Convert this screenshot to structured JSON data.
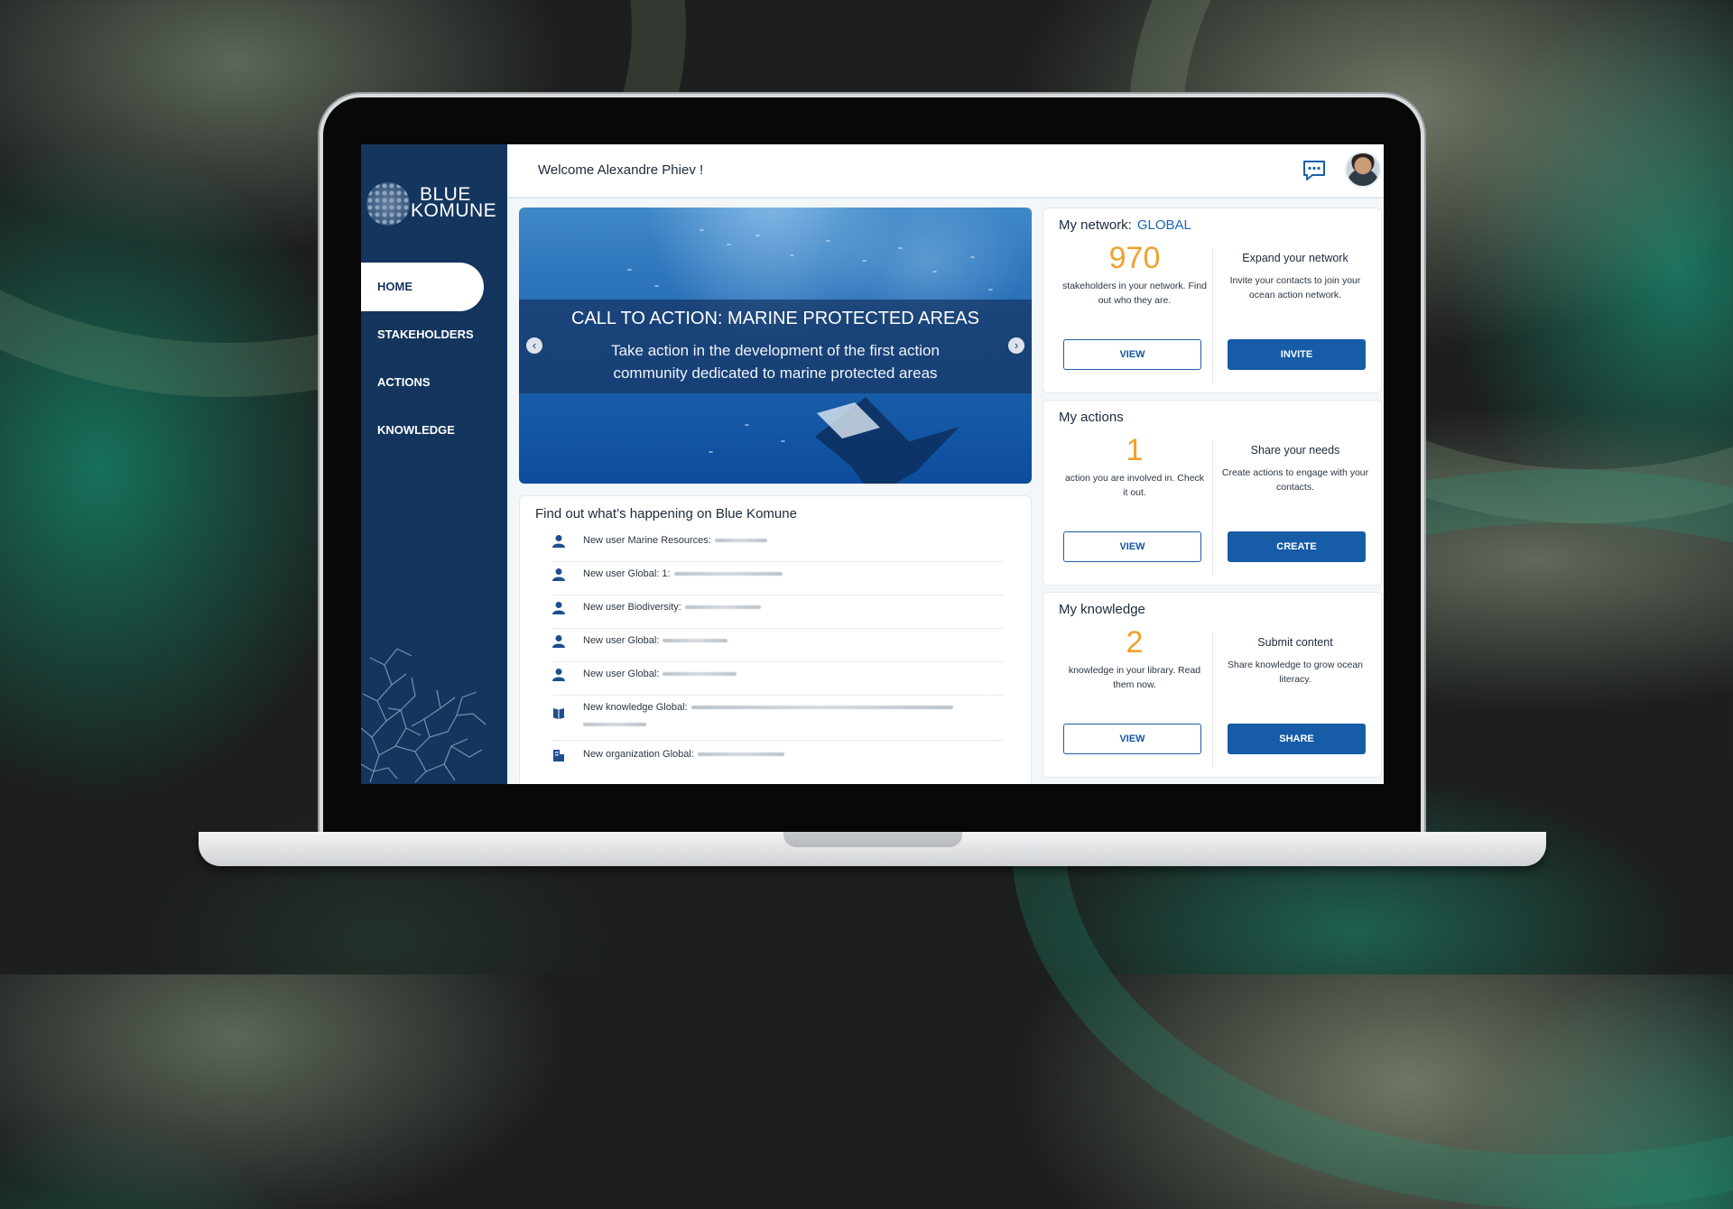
{
  "app": {
    "logo_line1": "BLUE",
    "logo_line2": "KOMUNE",
    "welcome": "Welcome Alexandre Phiev !"
  },
  "sidebar": {
    "items": [
      {
        "label": "HOME",
        "active": true
      },
      {
        "label": "STAKEHOLDERS",
        "active": false
      },
      {
        "label": "ACTIONS",
        "active": false
      },
      {
        "label": "KNOWLEDGE",
        "active": false
      }
    ]
  },
  "icons": {
    "chat": "chat-bubble-icon",
    "user": "user-icon",
    "book": "book-icon",
    "building": "building-icon",
    "prev": "chevron-left-icon",
    "next": "chevron-right-icon"
  },
  "hero": {
    "title": "CALL TO ACTION: MARINE PROTECTED AREAS",
    "text": "Take action in the development of the first action community dedicated to marine protected areas"
  },
  "feed": {
    "title": "Find out what’s happening on Blue Komune",
    "items": [
      {
        "icon": "user-icon",
        "text": "New user Marine Resources:"
      },
      {
        "icon": "user-icon",
        "text": "New user Global: 1:"
      },
      {
        "icon": "user-icon",
        "text": "New user Biodiversity:"
      },
      {
        "icon": "user-icon",
        "text": "New user Global:"
      },
      {
        "icon": "user-icon",
        "text": "New user Global:"
      },
      {
        "icon": "book-icon",
        "text": "New knowledge Global:"
      },
      {
        "icon": "building-icon",
        "text": "New organization Global:"
      }
    ]
  },
  "network": {
    "title": "My network:",
    "scope": "GLOBAL",
    "count": "970",
    "desc": "stakeholders in your network. Find out who they are.",
    "right_title": "Expand your network",
    "right_desc": "Invite your contacts to join your ocean action network.",
    "view_label": "VIEW",
    "action_label": "INVITE"
  },
  "actions": {
    "title": "My actions",
    "count": "1",
    "desc": "action you are involved in. Check it out.",
    "right_title": "Share your needs",
    "right_desc": "Create actions to engage with your contacts.",
    "view_label": "VIEW",
    "action_label": "CREATE"
  },
  "knowledge": {
    "title": "My knowledge",
    "count": "2",
    "desc": "knowledge in your library. Read them now.",
    "right_title": "Submit content",
    "right_desc": "Share knowledge to grow ocean literacy.",
    "view_label": "VIEW",
    "action_label": "SHARE"
  },
  "colors": {
    "sidebar": "#14355e",
    "accent": "#165ca7",
    "count": "#f0a12e",
    "scope": "#1a66b4"
  }
}
